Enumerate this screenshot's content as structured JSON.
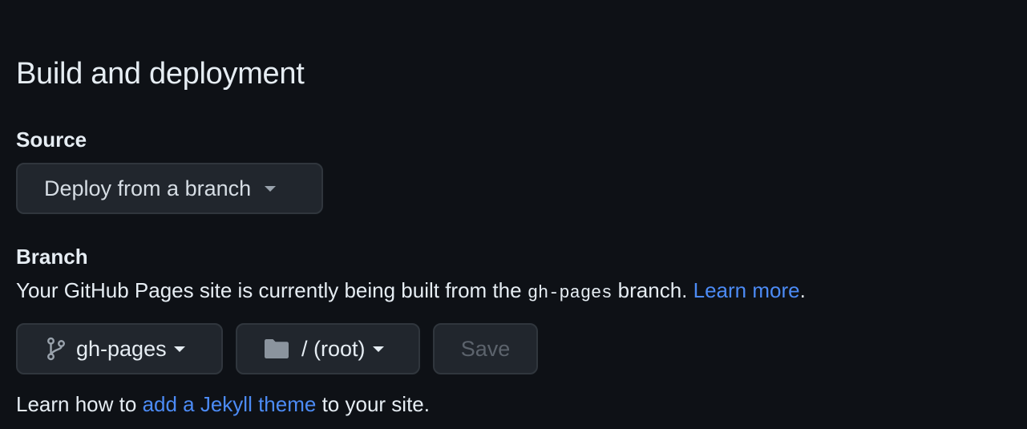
{
  "section": {
    "title": "Build and deployment"
  },
  "source": {
    "label": "Source",
    "selected": "Deploy from a branch"
  },
  "branch": {
    "label": "Branch",
    "description_prefix": "Your GitHub Pages site is currently being built from the ",
    "branch_code": "gh-pages",
    "description_suffix": " branch. ",
    "learn_more": "Learn more",
    "period": ".",
    "branch_select": "gh-pages",
    "folder_select": "/ (root)",
    "save_label": "Save"
  },
  "footer": {
    "prefix": "Learn how to ",
    "link": "add a Jekyll theme",
    "suffix": " to your site."
  },
  "icons": {
    "branch": "git-branch-icon",
    "folder": "folder-icon",
    "caret": "caret-down-icon"
  },
  "colors": {
    "background": "#0e1116",
    "link": "#4c8bf5",
    "button_bg": "#21262d",
    "button_border": "#30363d",
    "disabled_text": "#5c636c"
  }
}
